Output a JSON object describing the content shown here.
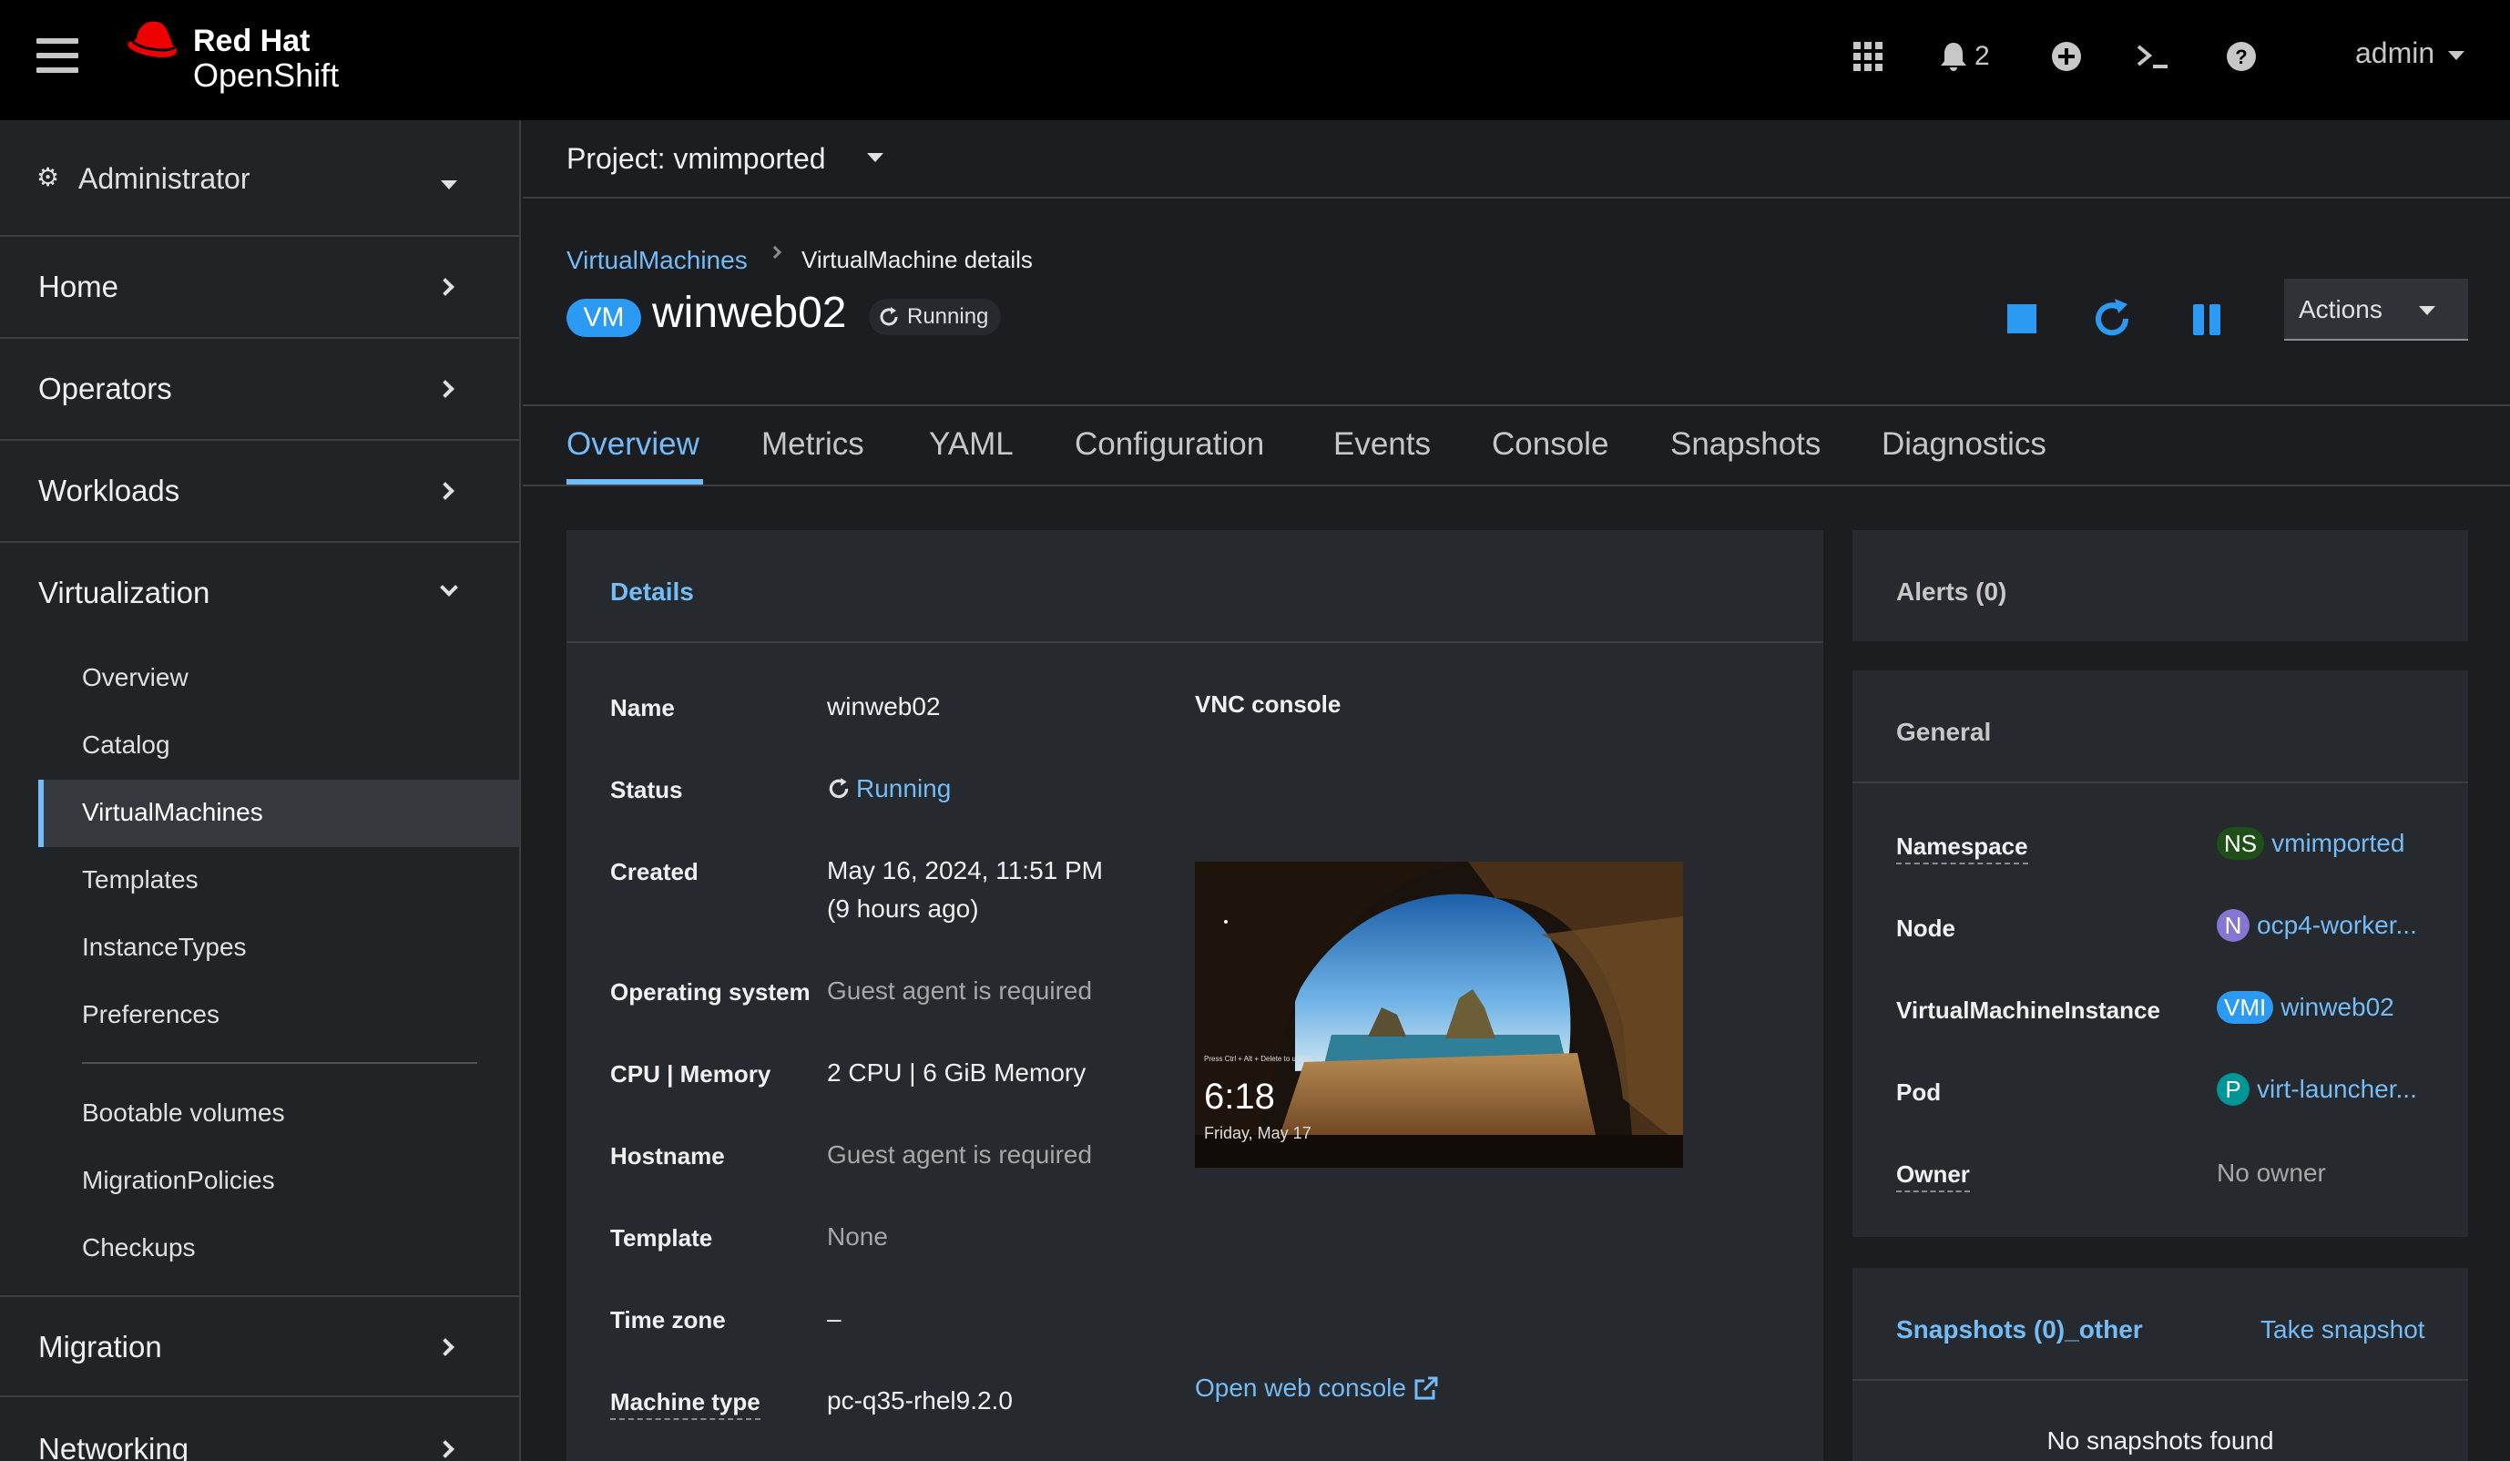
{
  "masthead": {
    "brand_line1": "Red Hat",
    "brand_line2": "OpenShift",
    "notifications_count": "2",
    "user": "admin"
  },
  "sidebar": {
    "perspective": "Administrator",
    "sections": [
      "Home",
      "Operators",
      "Workloads",
      "Virtualization",
      "Migration",
      "Networking"
    ],
    "virtualization_items": [
      "Overview",
      "Catalog",
      "VirtualMachines",
      "Templates",
      "InstanceTypes",
      "Preferences"
    ],
    "virtualization_items2": [
      "Bootable volumes",
      "MigrationPolicies",
      "Checkups"
    ],
    "active_item": "VirtualMachines"
  },
  "project": {
    "label": "Project: vmimported"
  },
  "header": {
    "breadcrumb_link": "VirtualMachines",
    "breadcrumb_current": "VirtualMachine details",
    "badge": "VM",
    "title": "winweb02",
    "status": "Running",
    "actions_label": "Actions"
  },
  "tabs": [
    "Overview",
    "Metrics",
    "YAML",
    "Configuration",
    "Events",
    "Console",
    "Snapshots",
    "Diagnostics"
  ],
  "details": {
    "title": "Details",
    "name_label": "Name",
    "name_value": "winweb02",
    "status_label": "Status",
    "status_value": "Running",
    "created_label": "Created",
    "created_value": "May 16, 2024, 11:51 PM",
    "created_relative": "(9 hours ago)",
    "os_label": "Operating system",
    "os_value": "Guest agent is required",
    "cpu_label": "CPU | Memory",
    "cpu_value": "2 CPU | 6 GiB Memory",
    "hostname_label": "Hostname",
    "hostname_value": "Guest agent is required",
    "template_label": "Template",
    "template_value": "None",
    "timezone_label": "Time zone",
    "timezone_value": "–",
    "machine_label": "Machine type",
    "machine_value": "pc-q35-rhel9.2.0",
    "vnc_label": "VNC console",
    "vnc_time": "6:18",
    "vnc_date": "Friday, May 17",
    "vnc_tiny": "Press Ctrl + Alt + Delete to unlock",
    "open_console": "Open web console"
  },
  "alerts": {
    "title": "Alerts (0)"
  },
  "general": {
    "title": "General",
    "namespace_label": "Namespace",
    "namespace_badge": "NS",
    "namespace_value": "vmimported",
    "node_label": "Node",
    "node_badge": "N",
    "node_value": "ocp4-worker...",
    "vmi_label": "VirtualMachineInstance",
    "vmi_badge": "VMI",
    "vmi_value": "winweb02",
    "pod_label": "Pod",
    "pod_badge": "P",
    "pod_value": "virt-launcher...",
    "owner_label": "Owner",
    "owner_value": "No owner"
  },
  "snapshots": {
    "title": "Snapshots (0)_other",
    "take": "Take snapshot",
    "empty": "No snapshots found"
  },
  "colors": {
    "accent": "#73bcf7",
    "badge_blue": "#2b9af3",
    "ns_green": "#1e4f18",
    "node_purple": "#8476d1",
    "pod_teal": "#009596"
  }
}
